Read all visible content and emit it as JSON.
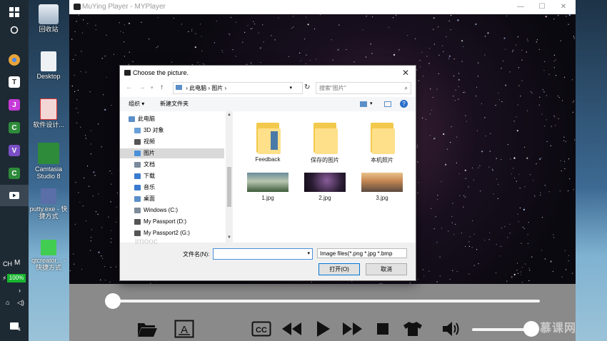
{
  "desktop": {
    "icons": [
      {
        "label": "回收站",
        "color": "#d0d0d0"
      },
      {
        "label": "Desktop",
        "color": "#e8e8e8"
      },
      {
        "label": "软件设计...",
        "color": "#e06060"
      },
      {
        "label": "Camtasia Studio 8",
        "color": "#2e8b3a"
      },
      {
        "label": "putty.exe - 快捷方式",
        "color": "#5a6ea8"
      },
      {
        "label": "qtcreator... - 快捷方式",
        "color": "#41cd52"
      }
    ]
  },
  "taskbar": {
    "items": [
      "windows-logo",
      "cortana",
      "chrome",
      "typora",
      "jetbrains",
      "camtasia",
      "visual-studio",
      "camtasia-recorder",
      "myplayer"
    ],
    "tray_lang1": "CH",
    "tray_lang2": "M",
    "battery": "100%",
    "notif_count": "4"
  },
  "player": {
    "title": "MuYing Player - MYPlayer",
    "seek_progress": 0.0,
    "volume_level": 0.95
  },
  "dialog": {
    "title": "Choose the picture.",
    "breadcrumb": [
      "此电脑",
      "图片"
    ],
    "search_placeholder": "搜索\"图片\"",
    "toolbar_organize": "组织 ▾",
    "toolbar_new_folder": "新建文件夹",
    "tree": [
      {
        "label": "此电脑",
        "indent": 0
      },
      {
        "label": "3D 对象",
        "indent": 1
      },
      {
        "label": "视频",
        "indent": 1
      },
      {
        "label": "图片",
        "indent": 1,
        "selected": true
      },
      {
        "label": "文档",
        "indent": 1
      },
      {
        "label": "下载",
        "indent": 1
      },
      {
        "label": "音乐",
        "indent": 1
      },
      {
        "label": "桌面",
        "indent": 1
      },
      {
        "label": "Windows (C:)",
        "indent": 1
      },
      {
        "label": "My Passport (D:)",
        "indent": 1
      },
      {
        "label": "My Passport2 (G:)",
        "indent": 1
      }
    ],
    "files": [
      {
        "name": "Feedback",
        "kind": "folder"
      },
      {
        "name": "保存的图片",
        "kind": "folder"
      },
      {
        "name": "本机照片",
        "kind": "folder"
      },
      {
        "name": "1.jpg",
        "kind": "image"
      },
      {
        "name": "2.jpg",
        "kind": "image"
      },
      {
        "name": "3.jpg",
        "kind": "image"
      }
    ],
    "filename_label": "文件名(N):",
    "filename_value": "",
    "filetype": "Image files(*.png *.jpg *.bmp",
    "open_button": "打开(O)",
    "cancel_button": "取消"
  },
  "watermark_imooc": "imooc",
  "watermark_logo": "慕课网"
}
